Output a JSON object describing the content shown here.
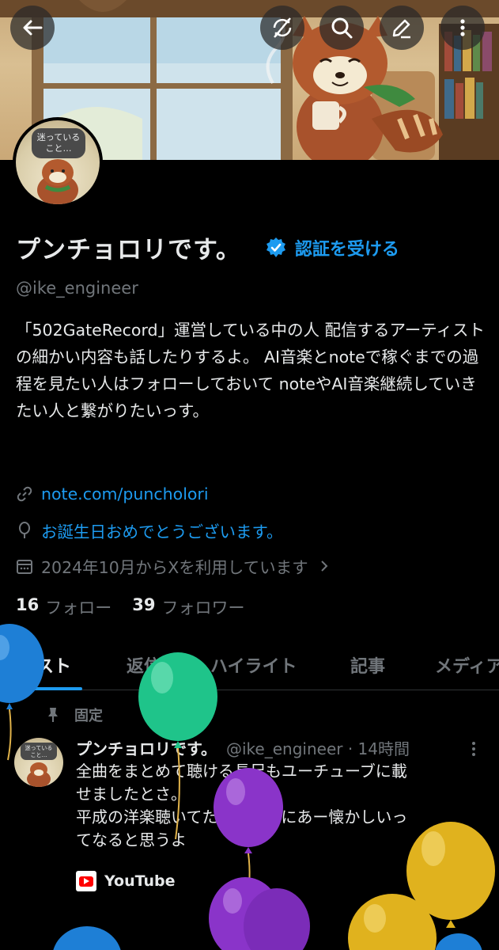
{
  "profile": {
    "avatar_thought": "迷っている\nこと…",
    "name": "プンチョロリです。",
    "verify_label": "認証を受ける",
    "handle": "@ike_engineer",
    "bio": "「502GateRecord」運営している中の人 配信するアーティストの細かい内容も話したりするよ。 AI音楽とnoteで稼ぐまでの過程を見たい人はフォローしておいて noteやAI音楽継続していきたい人と繋がりたいっす。",
    "website": "note.com/puncholori",
    "birthday": "お誕生日おめでとうございます。",
    "joined": "2024年10月からXを利用しています",
    "following_count": "16",
    "following_label": "フォロー",
    "followers_count": "39",
    "followers_label": "フォロワー"
  },
  "tabs": [
    {
      "label": "ポスト",
      "active": true
    },
    {
      "label": "返信",
      "active": false
    },
    {
      "label": "ハイライト",
      "active": false
    },
    {
      "label": "記事",
      "active": false
    },
    {
      "label": "メディア",
      "active": false
    }
  ],
  "post": {
    "pinned_label": "固定",
    "author": "プンチョロリです。",
    "meta": "@ike_engineer · 14時間",
    "text_lines": [
      "全曲をまとめて聴ける長尺もユーチューブに載",
      "せましたとさ。",
      "平成の洋楽聴いてた人は微妙にあー懐かしいっ",
      "てなると思うよ"
    ],
    "link_card": "YouTube"
  },
  "icons": {
    "back": "arrow-left-icon",
    "sync": "sync-off-icon",
    "search": "search-icon",
    "edit": "edit-icon",
    "more": "more-vertical-icon",
    "verified": "verified-badge-icon",
    "link": "link-icon",
    "birthday": "balloon-icon",
    "calendar": "calendar-icon",
    "pin": "pin-icon"
  },
  "colors": {
    "accent": "#1d9bf0",
    "muted": "#71767b",
    "text": "#e7e9ea",
    "background": "#000000"
  }
}
